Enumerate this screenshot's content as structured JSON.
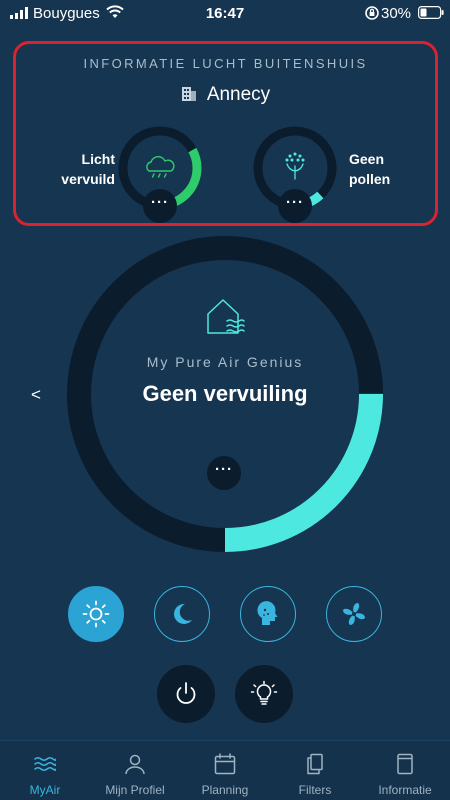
{
  "status_bar": {
    "carrier": "Bouygues",
    "time": "16:47",
    "battery_percent": "30%"
  },
  "outdoor": {
    "title": "INFORMATIE LUCHT BUITENSHUIS",
    "city": "Annecy",
    "pollution": {
      "label_line1": "Licht",
      "label_line2": "vervuild",
      "icon": "cloud-rain-icon",
      "level_fraction": 0.33,
      "color": "#2ecc6a",
      "more_label": "···"
    },
    "pollen": {
      "label_line1": "Geen",
      "label_line2": "pollen",
      "icon": "dandelion-icon",
      "level_fraction": 0.12,
      "color": "#4de8e0",
      "more_label": "···"
    }
  },
  "main": {
    "brand": "My Pure Air Genius",
    "status": "Geen vervuiling",
    "prev_label": "<",
    "level_fraction": 0.25,
    "color": "#4de8e0",
    "more_label": "···"
  },
  "modes": [
    {
      "name": "auto-mode",
      "icon": "sun-icon",
      "active": true
    },
    {
      "name": "night-mode",
      "icon": "moon-icon",
      "active": false
    },
    {
      "name": "allergy-mode",
      "icon": "allergy-head-icon",
      "active": false
    },
    {
      "name": "turbo-mode",
      "icon": "fan-icon",
      "active": false
    }
  ],
  "controls": {
    "power_icon": "power-icon",
    "light_icon": "light-bulb-icon"
  },
  "tabs": [
    {
      "label": "MyAir",
      "icon": "waves-icon",
      "active": true
    },
    {
      "label": "Mijn Profiel",
      "icon": "user-icon",
      "active": false
    },
    {
      "label": "Planning",
      "icon": "calendar-icon",
      "active": false
    },
    {
      "label": "Filters",
      "icon": "filters-icon",
      "active": false
    },
    {
      "label": "Informatie",
      "icon": "book-icon",
      "active": false
    }
  ],
  "colors": {
    "background": "#163550",
    "accent": "#39b5e0",
    "highlight_border": "#d9232e"
  }
}
